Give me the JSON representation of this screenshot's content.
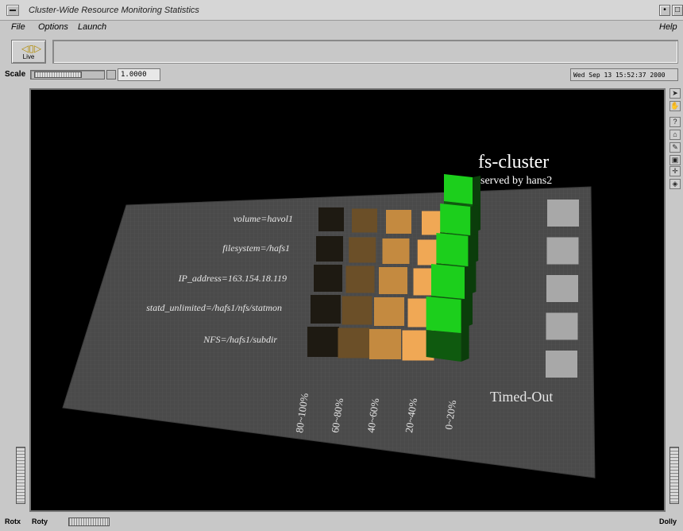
{
  "window": {
    "title": "Cluster-Wide Resource Monitoring Statistics",
    "min_btn": "•",
    "max_btn": "□"
  },
  "menu": {
    "file": "File",
    "options": "Options",
    "launch": "Launch",
    "help": "Help"
  },
  "toolbar": {
    "live_label": "Live",
    "message": ""
  },
  "scale": {
    "label": "Scale",
    "value": "1.0000"
  },
  "datetime": "Wed Sep 13 15:52:37 2000",
  "viewer_tools": [
    "arrow-icon",
    "hand-icon",
    "help-icon",
    "home-icon",
    "set-home-icon",
    "view-all-icon",
    "seek-icon",
    "perspective-icon"
  ],
  "viz": {
    "title": "hafs-cluster",
    "title_visible": "fs-cluster",
    "subtitle": "served by hans2",
    "rows": [
      "volume=havol1",
      "filesystem=/hafs1",
      "IP_address=163.154.18.119",
      "statd_unlimited=/hafs1/nfs/statmon",
      "NFS=/hafs1/subdir"
    ],
    "columns": [
      "80~100%",
      "60~80%",
      "40~60%",
      "20~40%",
      "0~20%"
    ],
    "timed_out_label": "Timed-Out",
    "active_column": "0~20%",
    "colors": {
      "c80_100": "#1e1a12",
      "c60_80": "#6b4f28",
      "c40_60": "#c48a40",
      "c20_40": "#f0a855",
      "active": "#1ccf1c",
      "timedout": "#a8a8a8",
      "plane": "#4a4a4a"
    }
  },
  "bottom": {
    "rotx": "Rotx",
    "roty": "Roty",
    "dolly": "Dolly"
  }
}
